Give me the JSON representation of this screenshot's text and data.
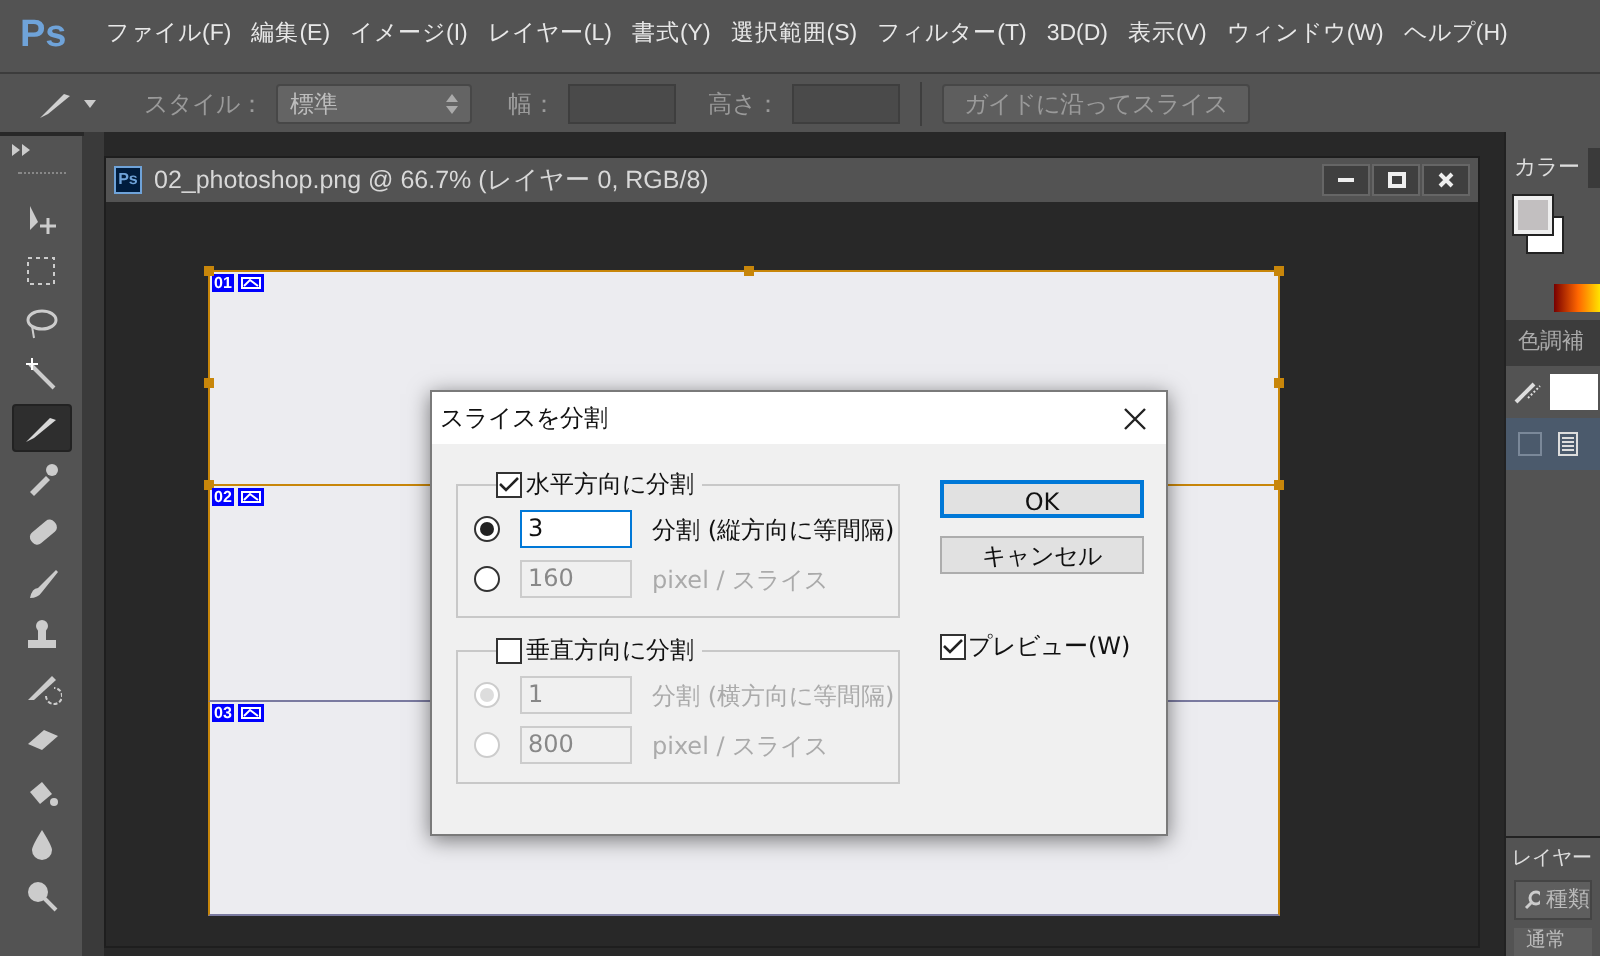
{
  "app_logo": "Ps",
  "menu": [
    "ファイル(F)",
    "編集(E)",
    "イメージ(I)",
    "レイヤー(L)",
    "書式(Y)",
    "選択範囲(S)",
    "フィルター(T)",
    "3D(D)",
    "表示(V)",
    "ウィンドウ(W)",
    "ヘルプ(H)"
  ],
  "options_bar": {
    "style_label": "スタイル：",
    "style_value": "標準",
    "width_label": "幅：",
    "height_label": "高さ：",
    "guide_button": "ガイドに沿ってスライス"
  },
  "tools": [
    {
      "kind": "move",
      "selected": false
    },
    {
      "kind": "marquee",
      "selected": false
    },
    {
      "kind": "lasso",
      "selected": false
    },
    {
      "kind": "wand",
      "selected": false
    },
    {
      "kind": "slice",
      "selected": true
    },
    {
      "kind": "eyedropper",
      "selected": false
    },
    {
      "kind": "healing",
      "selected": false
    },
    {
      "kind": "brush",
      "selected": false
    },
    {
      "kind": "stamp",
      "selected": false
    },
    {
      "kind": "history",
      "selected": false
    },
    {
      "kind": "eraser",
      "selected": false
    },
    {
      "kind": "bucket",
      "selected": false
    },
    {
      "kind": "blur",
      "selected": false
    },
    {
      "kind": "dodge",
      "selected": false
    }
  ],
  "document": {
    "file_icon": "Ps",
    "title": "02_photoshop.png @ 66.7% (レイヤー 0, RGB/8)",
    "slices": [
      {
        "number": "01",
        "selected": true
      },
      {
        "number": "02",
        "selected": false
      },
      {
        "number": "03",
        "selected": false
      }
    ]
  },
  "dialog": {
    "title": "スライスを分割",
    "groups": [
      {
        "label": "水平方向に分割",
        "checked": true,
        "options": [
          {
            "selected": true,
            "value": "3",
            "unit": "分割 (縦方向に等間隔)"
          },
          {
            "selected": false,
            "value": "160",
            "unit": "pixel / スライス"
          }
        ]
      },
      {
        "label": "垂直方向に分割",
        "checked": false,
        "options": [
          {
            "selected": true,
            "value": "1",
            "unit": "分割 (横方向に等間隔)"
          },
          {
            "selected": false,
            "value": "800",
            "unit": "pixel / スライス"
          }
        ]
      }
    ],
    "ok": "OK",
    "cancel": "キャンセル",
    "preview": {
      "label": "プレビュー(W)",
      "checked": true
    }
  },
  "right_panel": {
    "color_tab": "カラー",
    "adjust_tab": "色調補",
    "layers_tab": "レイヤー",
    "filter_placeholder": "種類",
    "blend_mode": "通常"
  }
}
